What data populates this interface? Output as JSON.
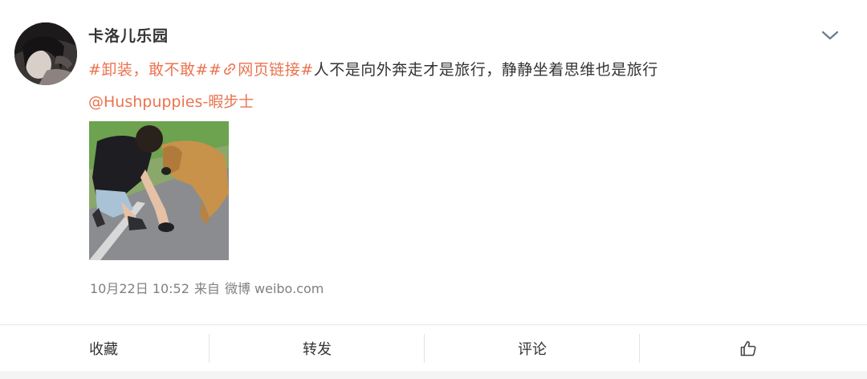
{
  "post": {
    "username": "卡洛儿乐园",
    "hashtag_1": "#卸装，敢不敢#",
    "link_prefix": "#",
    "link_icon": "link-icon",
    "link_text": "网页链接",
    "hashtag_2_open": "#",
    "body_text": "人不是向外奔走才是旅行，静静坐着思维也是旅行",
    "mention": "@Hushpuppies-暇步士",
    "timestamp": "10月22日 10:52",
    "source_prefix": "来自",
    "source": "微博 weibo.com"
  },
  "actions": {
    "favorite_label": "收藏",
    "repost_label": "转发",
    "comment_label": "评论",
    "like_icon": "thumbs-up-icon"
  },
  "colors": {
    "accent": "#eb7350",
    "text": "#333333",
    "meta": "#808080"
  }
}
